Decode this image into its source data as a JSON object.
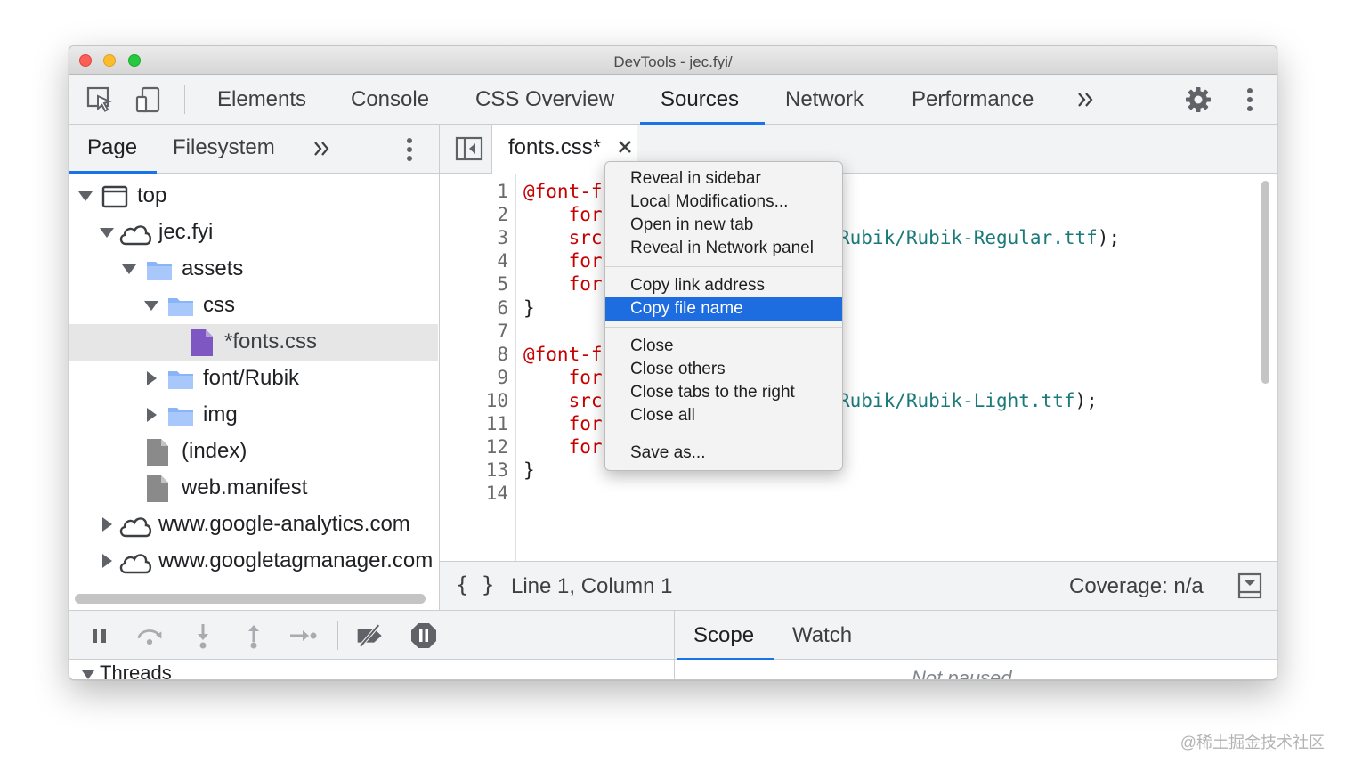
{
  "window": {
    "title": "DevTools - jec.fyi/"
  },
  "toolbar": {
    "tabs": [
      "Elements",
      "Console",
      "CSS Overview",
      "Sources",
      "Network",
      "Performance"
    ],
    "active_tab": "Sources",
    "more_icon": "chevron-double-right-icon",
    "icons": [
      "inspect-element-icon",
      "device-toggle-icon",
      "gear-icon",
      "kebab-menu-icon"
    ]
  },
  "navigator": {
    "tabs": [
      "Page",
      "Filesystem"
    ],
    "active_tab": "Page",
    "tree": [
      {
        "label": "top",
        "icon": "frame-icon",
        "expanded": true
      },
      {
        "label": "jec.fyi",
        "icon": "cloud-icon",
        "expanded": true
      },
      {
        "label": "assets",
        "icon": "folder-icon",
        "expanded": true
      },
      {
        "label": "css",
        "icon": "folder-icon",
        "expanded": true
      },
      {
        "label": "*fonts.css",
        "icon": "css-file-icon",
        "selected": true
      },
      {
        "label": "font/Rubik",
        "icon": "folder-icon",
        "expanded": false
      },
      {
        "label": "img",
        "icon": "folder-icon",
        "expanded": false
      },
      {
        "label": "(index)",
        "icon": "file-icon"
      },
      {
        "label": "web.manifest",
        "icon": "file-icon"
      },
      {
        "label": "www.google-analytics.com",
        "icon": "cloud-icon",
        "expanded": false
      },
      {
        "label": "www.googletagmanager.com",
        "icon": "cloud-icon",
        "expanded": false
      }
    ]
  },
  "editor": {
    "tab_label": "fonts.css*",
    "line_numbers": [
      "1",
      "2",
      "3",
      "4",
      "5",
      "6",
      "7",
      "8",
      "9",
      "10",
      "11",
      "12",
      "13",
      "14"
    ],
    "lines": [
      {
        "kw": "@font-f",
        "rest": ""
      },
      {
        "kw": "    for",
        "rest": ""
      },
      {
        "kw": "    src",
        "rest": ""
      },
      {
        "kw": "    for",
        "rest": ""
      },
      {
        "kw": "    for",
        "rest": ""
      },
      {
        "kw": "",
        "rest": "}"
      },
      {
        "kw": "",
        "rest": ""
      },
      {
        "kw": "@font-f",
        "rest": ""
      },
      {
        "kw": "    for",
        "rest": ""
      },
      {
        "kw": "    src",
        "rest": ""
      },
      {
        "kw": "    for",
        "rest": ""
      },
      {
        "kw": "    for",
        "rest": ""
      },
      {
        "kw": "",
        "rest": "}"
      },
      {
        "kw": "",
        "rest": ""
      }
    ],
    "line3_tail": "Rubik/Rubik-Regular.ttf",
    "line10_tail": "Rubik/Rubik-Light.ttf",
    "tail_suffix": ");"
  },
  "status": {
    "format_icon": "{ }",
    "position": "Line 1, Column 1",
    "coverage": "Coverage: n/a"
  },
  "debugger": {
    "icons": [
      "pause-icon",
      "step-over-icon",
      "step-into-icon",
      "step-out-icon",
      "step-icon",
      "deactivate-breakpoints-icon",
      "pause-on-exceptions-icon"
    ],
    "threads_label": "Threads",
    "scope_tabs": [
      "Scope",
      "Watch"
    ],
    "active_scope_tab": "Scope",
    "not_paused": "Not paused"
  },
  "context_menu": {
    "groups": [
      [
        "Reveal in sidebar",
        "Local Modifications...",
        "Open in new tab",
        "Reveal in Network panel"
      ],
      [
        "Copy link address",
        "Copy file name"
      ],
      [
        "Close",
        "Close others",
        "Close tabs to the right",
        "Close all"
      ],
      [
        "Save as..."
      ]
    ],
    "highlighted": "Copy file name"
  },
  "watermark": "@稀土掘金技术社区",
  "colors": {
    "accent": "#1a73e8",
    "menu_highlight": "#1d6ce0",
    "css_keyword": "#c80000",
    "css_string": "#1a7a7a"
  }
}
